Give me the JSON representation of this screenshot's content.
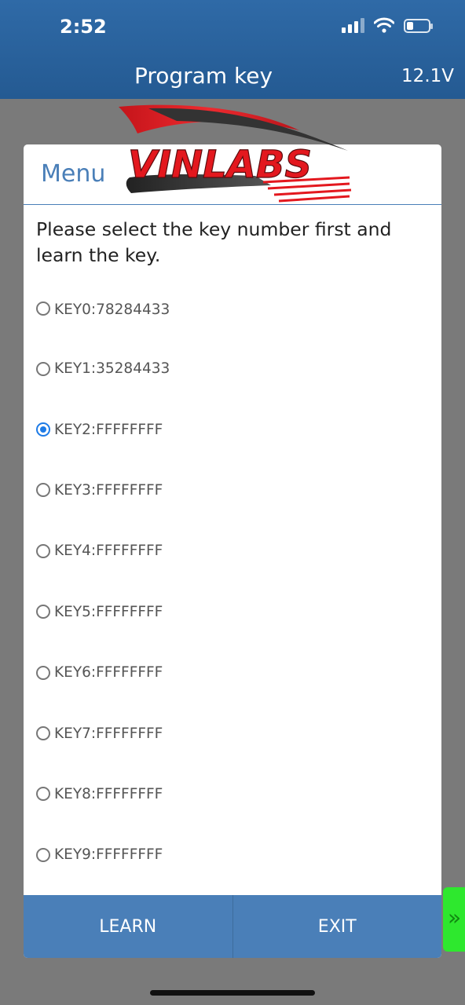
{
  "status_bar": {
    "time": "2:52"
  },
  "header": {
    "title": "Program key",
    "voltage": "12.1V"
  },
  "logo": {
    "text": "VINLABS"
  },
  "dialog": {
    "menu_title": "Menu",
    "prompt": "Please select the key number first and learn the key.",
    "options": [
      {
        "label": "KEY0:78284433",
        "selected": false
      },
      {
        "label": "KEY1:35284433",
        "selected": false
      },
      {
        "label": "KEY2:FFFFFFFF",
        "selected": true
      },
      {
        "label": "KEY3:FFFFFFFF",
        "selected": false
      },
      {
        "label": "KEY4:FFFFFFFF",
        "selected": false
      },
      {
        "label": "KEY5:FFFFFFFF",
        "selected": false
      },
      {
        "label": "KEY6:FFFFFFFF",
        "selected": false
      },
      {
        "label": "KEY7:FFFFFFFF",
        "selected": false
      },
      {
        "label": "KEY8:FFFFFFFF",
        "selected": false
      },
      {
        "label": "KEY9:FFFFFFFF",
        "selected": false
      }
    ],
    "learn_label": "LEARN",
    "exit_label": "EXIT"
  },
  "icons": {
    "signal": "cellular-signal-icon",
    "wifi": "wifi-icon",
    "battery": "battery-icon",
    "side_tab": "double-chevron-right-icon"
  },
  "colors": {
    "header": "#2f6aa7",
    "accent": "#4a7fb8",
    "radio_selected": "#1e7be6",
    "side_tab": "#2ee82e",
    "logo_red": "#e3181e"
  }
}
